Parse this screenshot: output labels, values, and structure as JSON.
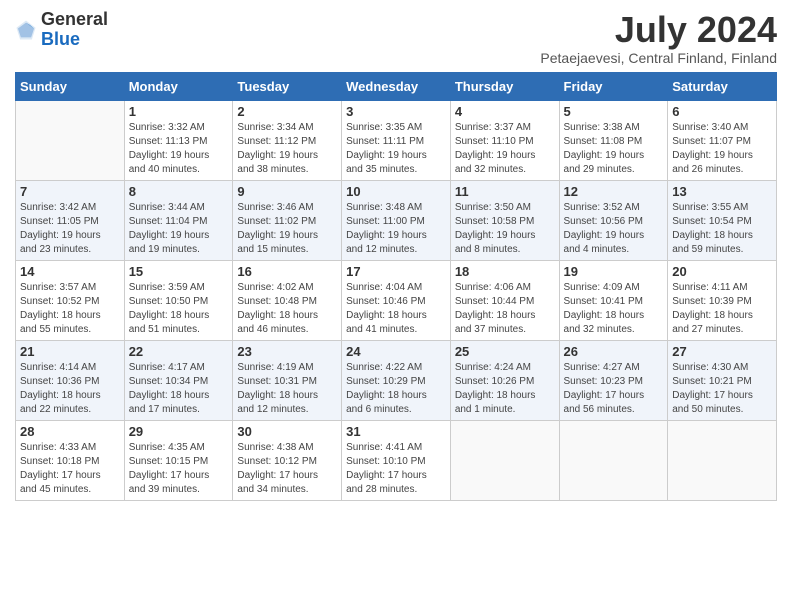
{
  "logo": {
    "general": "General",
    "blue": "Blue"
  },
  "title": {
    "month_year": "July 2024",
    "location": "Petaejaevesi, Central Finland, Finland"
  },
  "days_of_week": [
    "Sunday",
    "Monday",
    "Tuesday",
    "Wednesday",
    "Thursday",
    "Friday",
    "Saturday"
  ],
  "weeks": [
    [
      {
        "day": "",
        "info": ""
      },
      {
        "day": "1",
        "info": "Sunrise: 3:32 AM\nSunset: 11:13 PM\nDaylight: 19 hours and 40 minutes."
      },
      {
        "day": "2",
        "info": "Sunrise: 3:34 AM\nSunset: 11:12 PM\nDaylight: 19 hours and 38 minutes."
      },
      {
        "day": "3",
        "info": "Sunrise: 3:35 AM\nSunset: 11:11 PM\nDaylight: 19 hours and 35 minutes."
      },
      {
        "day": "4",
        "info": "Sunrise: 3:37 AM\nSunset: 11:10 PM\nDaylight: 19 hours and 32 minutes."
      },
      {
        "day": "5",
        "info": "Sunrise: 3:38 AM\nSunset: 11:08 PM\nDaylight: 19 hours and 29 minutes."
      },
      {
        "day": "6",
        "info": "Sunrise: 3:40 AM\nSunset: 11:07 PM\nDaylight: 19 hours and 26 minutes."
      }
    ],
    [
      {
        "day": "7",
        "info": "Sunrise: 3:42 AM\nSunset: 11:05 PM\nDaylight: 19 hours and 23 minutes."
      },
      {
        "day": "8",
        "info": "Sunrise: 3:44 AM\nSunset: 11:04 PM\nDaylight: 19 hours and 19 minutes."
      },
      {
        "day": "9",
        "info": "Sunrise: 3:46 AM\nSunset: 11:02 PM\nDaylight: 19 hours and 15 minutes."
      },
      {
        "day": "10",
        "info": "Sunrise: 3:48 AM\nSunset: 11:00 PM\nDaylight: 19 hours and 12 minutes."
      },
      {
        "day": "11",
        "info": "Sunrise: 3:50 AM\nSunset: 10:58 PM\nDaylight: 19 hours and 8 minutes."
      },
      {
        "day": "12",
        "info": "Sunrise: 3:52 AM\nSunset: 10:56 PM\nDaylight: 19 hours and 4 minutes."
      },
      {
        "day": "13",
        "info": "Sunrise: 3:55 AM\nSunset: 10:54 PM\nDaylight: 18 hours and 59 minutes."
      }
    ],
    [
      {
        "day": "14",
        "info": "Sunrise: 3:57 AM\nSunset: 10:52 PM\nDaylight: 18 hours and 55 minutes."
      },
      {
        "day": "15",
        "info": "Sunrise: 3:59 AM\nSunset: 10:50 PM\nDaylight: 18 hours and 51 minutes."
      },
      {
        "day": "16",
        "info": "Sunrise: 4:02 AM\nSunset: 10:48 PM\nDaylight: 18 hours and 46 minutes."
      },
      {
        "day": "17",
        "info": "Sunrise: 4:04 AM\nSunset: 10:46 PM\nDaylight: 18 hours and 41 minutes."
      },
      {
        "day": "18",
        "info": "Sunrise: 4:06 AM\nSunset: 10:44 PM\nDaylight: 18 hours and 37 minutes."
      },
      {
        "day": "19",
        "info": "Sunrise: 4:09 AM\nSunset: 10:41 PM\nDaylight: 18 hours and 32 minutes."
      },
      {
        "day": "20",
        "info": "Sunrise: 4:11 AM\nSunset: 10:39 PM\nDaylight: 18 hours and 27 minutes."
      }
    ],
    [
      {
        "day": "21",
        "info": "Sunrise: 4:14 AM\nSunset: 10:36 PM\nDaylight: 18 hours and 22 minutes."
      },
      {
        "day": "22",
        "info": "Sunrise: 4:17 AM\nSunset: 10:34 PM\nDaylight: 18 hours and 17 minutes."
      },
      {
        "day": "23",
        "info": "Sunrise: 4:19 AM\nSunset: 10:31 PM\nDaylight: 18 hours and 12 minutes."
      },
      {
        "day": "24",
        "info": "Sunrise: 4:22 AM\nSunset: 10:29 PM\nDaylight: 18 hours and 6 minutes."
      },
      {
        "day": "25",
        "info": "Sunrise: 4:24 AM\nSunset: 10:26 PM\nDaylight: 18 hours and 1 minute."
      },
      {
        "day": "26",
        "info": "Sunrise: 4:27 AM\nSunset: 10:23 PM\nDaylight: 17 hours and 56 minutes."
      },
      {
        "day": "27",
        "info": "Sunrise: 4:30 AM\nSunset: 10:21 PM\nDaylight: 17 hours and 50 minutes."
      }
    ],
    [
      {
        "day": "28",
        "info": "Sunrise: 4:33 AM\nSunset: 10:18 PM\nDaylight: 17 hours and 45 minutes."
      },
      {
        "day": "29",
        "info": "Sunrise: 4:35 AM\nSunset: 10:15 PM\nDaylight: 17 hours and 39 minutes."
      },
      {
        "day": "30",
        "info": "Sunrise: 4:38 AM\nSunset: 10:12 PM\nDaylight: 17 hours and 34 minutes."
      },
      {
        "day": "31",
        "info": "Sunrise: 4:41 AM\nSunset: 10:10 PM\nDaylight: 17 hours and 28 minutes."
      },
      {
        "day": "",
        "info": ""
      },
      {
        "day": "",
        "info": ""
      },
      {
        "day": "",
        "info": ""
      }
    ]
  ]
}
